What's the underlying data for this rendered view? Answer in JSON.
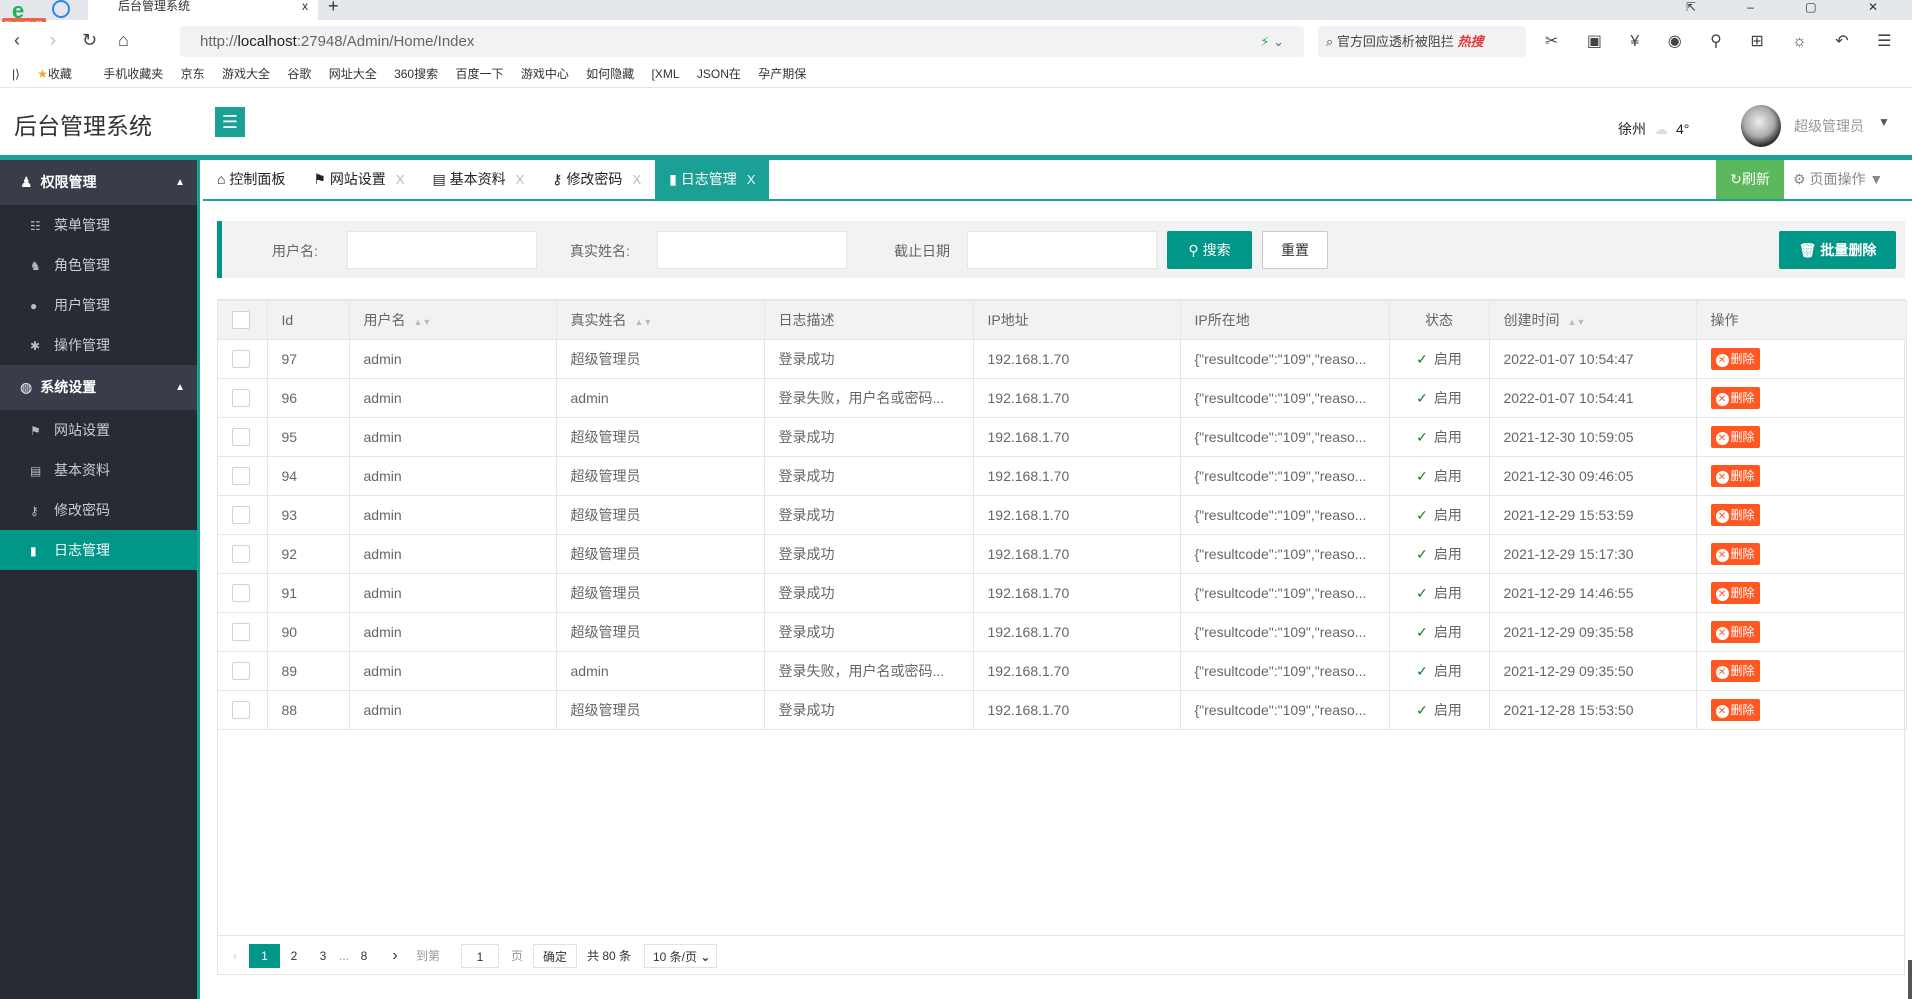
{
  "browser": {
    "tab_title": "后台管理系统",
    "login_badge": "登录账号",
    "url_prefix": "http://",
    "url_host": "localhost",
    "url_path": ":27948/Admin/Home/Index",
    "search_text": "官方回应透析被阻拦",
    "search_hot": "热搜",
    "bookmarks": [
      "收藏",
      "手机收藏夹",
      "京东",
      "游戏大全",
      "谷歌",
      "网址大全",
      "360搜索",
      "百度一下",
      "游戏中心",
      "如何隐藏",
      "[XML",
      "JSON在",
      "孕产期保"
    ]
  },
  "header": {
    "title": "后台管理系统",
    "city": "徐州",
    "temp": "4°",
    "user": "超级管理员"
  },
  "sidebar": {
    "groups": [
      {
        "label": "权限管理",
        "items": [
          "菜单管理",
          "角色管理",
          "用户管理",
          "操作管理"
        ]
      },
      {
        "label": "系统设置",
        "items": [
          "网站设置",
          "基本资料",
          "修改密码",
          "日志管理"
        ]
      }
    ],
    "active": "日志管理"
  },
  "tabs": [
    {
      "label": "控制面板"
    },
    {
      "label": "网站设置"
    },
    {
      "label": "基本资料"
    },
    {
      "label": "修改密码"
    },
    {
      "label": "日志管理",
      "active": true
    }
  ],
  "tab_close": "X",
  "refresh": "刷新",
  "page_ops": "页面操作",
  "search": {
    "user_label": "用户名:",
    "real_label": "真实姓名:",
    "date_label": "截止日期",
    "search_btn": "搜索",
    "reset_btn": "重置",
    "batch_delete": "批量删除"
  },
  "table": {
    "headers": [
      "Id",
      "用户名",
      "真实姓名",
      "日志描述",
      "IP地址",
      "IP所在地",
      "状态",
      "创建时间",
      "操作"
    ],
    "rows": [
      [
        "97",
        "admin",
        "超级管理员",
        "登录成功",
        "192.168.1.70",
        "{\"resultcode\":\"109\",\"reaso...",
        "启用",
        "2022-01-07 10:54:47"
      ],
      [
        "96",
        "admin",
        "admin",
        "登录失败，用户名或密码...",
        "192.168.1.70",
        "{\"resultcode\":\"109\",\"reaso...",
        "启用",
        "2022-01-07 10:54:41"
      ],
      [
        "95",
        "admin",
        "超级管理员",
        "登录成功",
        "192.168.1.70",
        "{\"resultcode\":\"109\",\"reaso...",
        "启用",
        "2021-12-30 10:59:05"
      ],
      [
        "94",
        "admin",
        "超级管理员",
        "登录成功",
        "192.168.1.70",
        "{\"resultcode\":\"109\",\"reaso...",
        "启用",
        "2021-12-30 09:46:05"
      ],
      [
        "93",
        "admin",
        "超级管理员",
        "登录成功",
        "192.168.1.70",
        "{\"resultcode\":\"109\",\"reaso...",
        "启用",
        "2021-12-29 15:53:59"
      ],
      [
        "92",
        "admin",
        "超级管理员",
        "登录成功",
        "192.168.1.70",
        "{\"resultcode\":\"109\",\"reaso...",
        "启用",
        "2021-12-29 15:17:30"
      ],
      [
        "91",
        "admin",
        "超级管理员",
        "登录成功",
        "192.168.1.70",
        "{\"resultcode\":\"109\",\"reaso...",
        "启用",
        "2021-12-29 14:46:55"
      ],
      [
        "90",
        "admin",
        "超级管理员",
        "登录成功",
        "192.168.1.70",
        "{\"resultcode\":\"109\",\"reaso...",
        "启用",
        "2021-12-29 09:35:58"
      ],
      [
        "89",
        "admin",
        "admin",
        "登录失败，用户名或密码...",
        "192.168.1.70",
        "{\"resultcode\":\"109\",\"reaso...",
        "启用",
        "2021-12-29 09:35:50"
      ],
      [
        "88",
        "admin",
        "超级管理员",
        "登录成功",
        "192.168.1.70",
        "{\"resultcode\":\"109\",\"reaso...",
        "启用",
        "2021-12-28 15:53:50"
      ]
    ],
    "delete_label": "删除"
  },
  "pager": {
    "pages": [
      "1",
      "2",
      "3",
      "8"
    ],
    "ellipsis": "...",
    "current": "1",
    "goto_label": "到第",
    "goto_value": "1",
    "page_unit": "页",
    "confirm": "确定",
    "total": "共 80 条",
    "page_size": "10 条/页"
  },
  "colors": {
    "teal": "#009688",
    "header_teal": "#1aa094",
    "danger": "#ff5722",
    "refresh": "#5cb85c"
  }
}
